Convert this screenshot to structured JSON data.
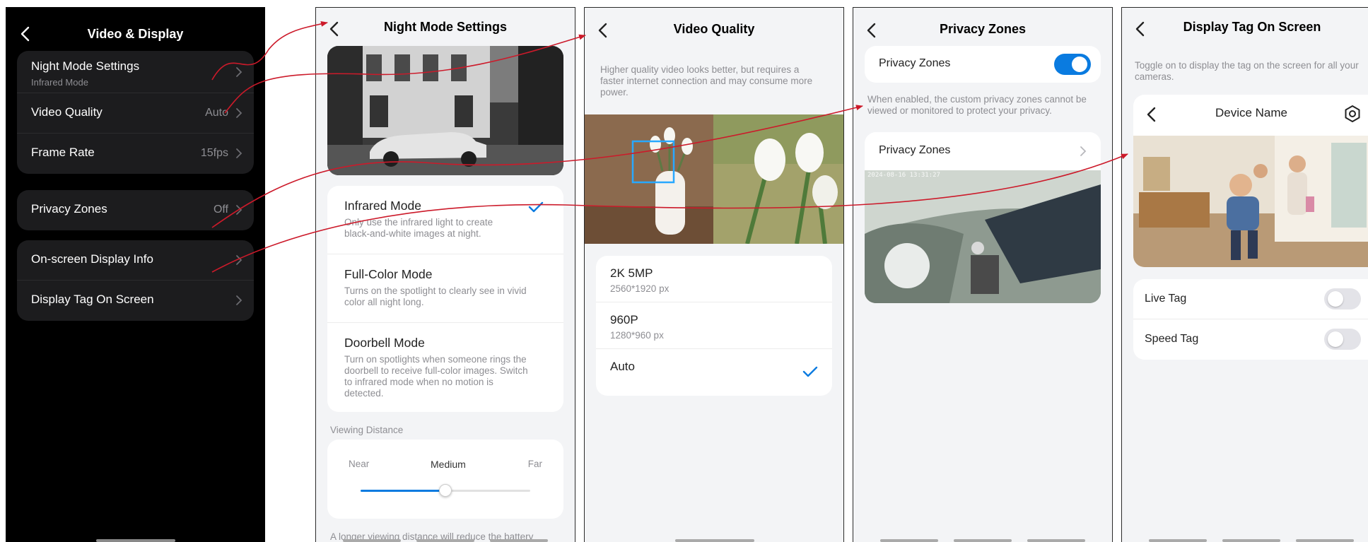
{
  "screen1": {
    "title": "Video & Display",
    "night_mode": {
      "label": "Night Mode Settings",
      "sub": "Infrared Mode"
    },
    "video_quality": {
      "label": "Video Quality",
      "value": "Auto"
    },
    "frame_rate": {
      "label": "Frame Rate",
      "value": "15fps"
    },
    "privacy": {
      "label": "Privacy Zones",
      "value": "Off"
    },
    "osd": {
      "label": "On-screen Display Info"
    },
    "display_tag": {
      "label": "Display Tag On Screen"
    }
  },
  "screen2": {
    "title": "Night Mode Settings",
    "modes": [
      {
        "name": "Infrared Mode",
        "desc": "Only use the infrared light to create black-and-white images at night.",
        "selected": true
      },
      {
        "name": "Full-Color Mode",
        "desc": "Turns on the spotlight to clearly see in vivid color all night long.",
        "selected": false
      },
      {
        "name": "Doorbell Mode",
        "desc": "Turn on spotlights when someone rings the doorbell to receive full-color images. Switch to infrared mode when no motion is detected.",
        "selected": false
      }
    ],
    "viewing_distance": {
      "label": "Viewing Distance",
      "near": "Near",
      "medium": "Medium",
      "far": "Far",
      "level": 0.5
    },
    "footer": "A longer viewing distance will reduce the battery"
  },
  "screen3": {
    "title": "Video Quality",
    "desc": "Higher quality video looks better, but requires a faster internet connection and may consume more power.",
    "options": [
      {
        "name": "2K 5MP",
        "sub": "2560*1920 px",
        "selected": false
      },
      {
        "name": "960P",
        "sub": "1280*960 px",
        "selected": false
      },
      {
        "name": "Auto",
        "sub": "",
        "selected": true
      }
    ]
  },
  "screen4": {
    "title": "Privacy Zones",
    "toggle_label": "Privacy Zones",
    "toggle_on": true,
    "desc": "When enabled, the custom privacy zones cannot be viewed or monitored to protect your privacy.",
    "link_label": "Privacy Zones",
    "timestamp": "2024-08-16 13:31:27"
  },
  "screen5": {
    "title": "Display Tag On Screen",
    "desc": "Toggle on to display the tag on the screen for all your cameras.",
    "device_name": "Device Name",
    "tags": [
      {
        "name": "Live Tag",
        "on": false
      },
      {
        "name": "Speed Tag",
        "on": false
      }
    ]
  },
  "colors": {
    "accent": "#0a7be0",
    "arrow": "#cc1a2a",
    "dark_bg": "#000000",
    "dark_card": "#1c1c1e"
  },
  "icons": {
    "back": "chevron-left-icon",
    "next": "chevron-right-icon",
    "check": "checkmark-icon",
    "settings": "gear-icon"
  }
}
